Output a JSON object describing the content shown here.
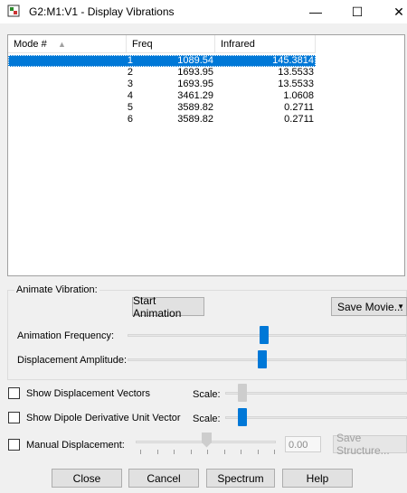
{
  "window": {
    "title": "G2:M1:V1 - Display Vibrations",
    "minimize_glyph": "—",
    "maximize_glyph": "☐",
    "close_glyph": "✕"
  },
  "table": {
    "headers": [
      "Mode #",
      "Freq",
      "Infrared"
    ],
    "sort_glyph": "▲",
    "rows": [
      {
        "mode": "1",
        "freq": "1089.54",
        "ir": "145.3814",
        "selected": true
      },
      {
        "mode": "2",
        "freq": "1693.95",
        "ir": "13.5533"
      },
      {
        "mode": "3",
        "freq": "1693.95",
        "ir": "13.5533"
      },
      {
        "mode": "4",
        "freq": "3461.29",
        "ir": "1.0608"
      },
      {
        "mode": "5",
        "freq": "3589.82",
        "ir": "0.2711"
      },
      {
        "mode": "6",
        "freq": "3589.82",
        "ir": "0.2711"
      }
    ]
  },
  "animate": {
    "group_label": "Animate Vibration:",
    "start_label": "Start Animation",
    "save_movie_label": "Save Movie...",
    "save_movie_arrow": "▼",
    "frequency_label": "Animation Frequency:",
    "amplitude_label": "Displacement Amplitude:"
  },
  "options": {
    "show_vectors_label": "Show Displacement Vectors",
    "show_dipole_label": "Show Dipole Derivative Unit Vector",
    "manual_label": "Manual Displacement:",
    "scale_label": "Scale:",
    "manual_value": "0.00",
    "save_structure_label": "Save Structure..."
  },
  "buttons": {
    "close": "Close",
    "cancel": "Cancel",
    "spectrum": "Spectrum",
    "help": "Help"
  },
  "colors": {
    "accent": "#0078d7"
  }
}
